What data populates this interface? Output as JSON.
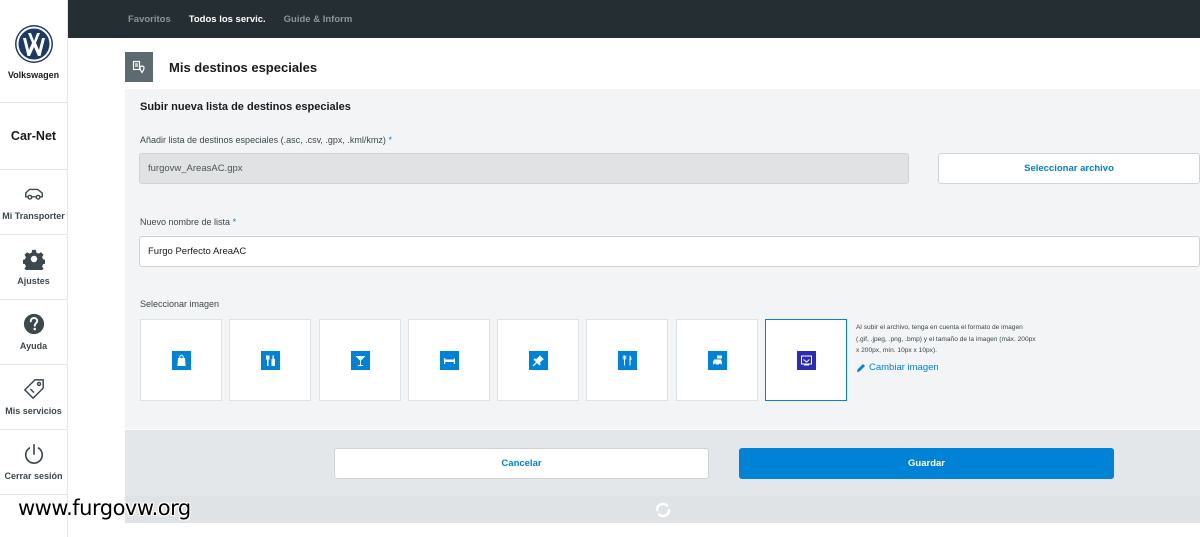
{
  "sidebar": {
    "brand_name": "Volkswagen",
    "app_name": "Car-Net",
    "items": [
      {
        "label": "Mi Transporter",
        "icon": "car-icon"
      },
      {
        "label": "Ajustes",
        "icon": "gear-icon"
      },
      {
        "label": "Ayuda",
        "icon": "help-icon"
      },
      {
        "label": "Mis servicios",
        "icon": "tag-icon"
      },
      {
        "label": "Cerrar sesión",
        "icon": "power-icon"
      }
    ]
  },
  "topbar": {
    "tabs": [
      {
        "label": "Favoritos",
        "active": false
      },
      {
        "label": "Todos los servic.",
        "active": true
      },
      {
        "label": "Guide & Inform",
        "active": false
      }
    ]
  },
  "page": {
    "title": "Mis destinos especiales",
    "title_icon": "pin-list-icon"
  },
  "form": {
    "section_title": "Subir nueva lista de destinos especiales",
    "file_label": "Añadir lista de destinos especiales (.asc, .csv, .gpx, .kml/kmz)",
    "required_mark": "*",
    "file_value": "furgovw_AreasAC.gpx",
    "select_file_label": "Seleccionar archivo",
    "name_label": "Nuevo nombre de lista",
    "name_value": "Furgo Perfecto AreaAC",
    "image_label": "Seleccionar imagen",
    "images": [
      {
        "icon": "shopping-bag-icon",
        "selected": false
      },
      {
        "icon": "tools-icon",
        "selected": false
      },
      {
        "icon": "cocktail-icon",
        "selected": false
      },
      {
        "icon": "bed-icon",
        "selected": false
      },
      {
        "icon": "pushpin-icon",
        "selected": false
      },
      {
        "icon": "cutlery-icon",
        "selected": false
      },
      {
        "icon": "car-service-icon",
        "selected": false
      },
      {
        "icon": "custom-image-icon",
        "selected": true
      }
    ],
    "hint": "Al subir el archivo, tenga en cuenta el formato de imagen (.gif, .jpeg, .png, .bmp) y el tamaño de la imagen (máx. 200px x 200px, mín. 10px x 10px).",
    "change_image_label": "Cambiar imagen"
  },
  "footer": {
    "cancel_label": "Cancelar",
    "save_label": "Guardar"
  },
  "watermark": "www.furgovw.org",
  "colors": {
    "accent": "#0082d6",
    "topbar": "#252e33",
    "panel": "#f2f4f5",
    "selected_chip": "#2d2ab5"
  }
}
